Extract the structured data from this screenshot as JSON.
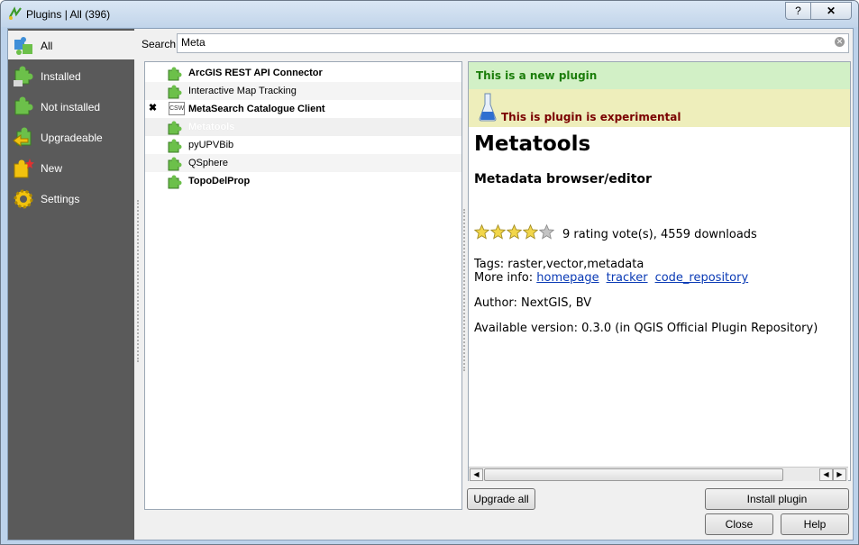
{
  "window": {
    "title": "Plugins | All (396)",
    "help_glyph": "?",
    "close_glyph": "✕"
  },
  "sidebar": {
    "items": [
      {
        "label": "All",
        "icon": "puzzle-all-icon",
        "active": true
      },
      {
        "label": "Installed",
        "icon": "puzzle-installed-icon"
      },
      {
        "label": "Not installed",
        "icon": "puzzle-not-installed-icon"
      },
      {
        "label": "Upgradeable",
        "icon": "puzzle-upgradeable-icon"
      },
      {
        "label": "New",
        "icon": "puzzle-new-icon"
      },
      {
        "label": "Settings",
        "icon": "gear-icon"
      }
    ]
  },
  "search": {
    "label": "Search",
    "value": "Meta"
  },
  "plugin_list": [
    {
      "name": "ArcGIS REST API Connector",
      "bold": true,
      "checked": false,
      "icon": "puzzle-icon"
    },
    {
      "name": "Interactive Map Tracking",
      "bold": false,
      "checked": false,
      "icon": "puzzle-icon"
    },
    {
      "name": "MetaSearch Catalogue Client",
      "bold": true,
      "checked": true,
      "check_glyph": "✖",
      "icon": "csw-icon",
      "icon_text": "CSW"
    },
    {
      "name": "Metatools",
      "bold": true,
      "checked": false,
      "selected": true,
      "icon": "puzzle-icon"
    },
    {
      "name": "pyUPVBib",
      "bold": false,
      "checked": false,
      "icon": "puzzle-icon"
    },
    {
      "name": "QSphere",
      "bold": false,
      "checked": false,
      "icon": "puzzle-icon"
    },
    {
      "name": "TopoDelProp",
      "bold": true,
      "checked": false,
      "icon": "puzzle-icon"
    }
  ],
  "detail": {
    "new_banner": "This is a new plugin",
    "experimental_banner": "This is plugin is experimental",
    "title": "Metatools",
    "subtitle": "Metadata browser/editor",
    "rating_stars": 4,
    "rating_max": 5,
    "rating_text": "9 rating vote(s), 4559 downloads",
    "tags_line": "Tags: raster,vector,metadata",
    "more_info_label": "More info:",
    "links": [
      "homepage",
      "tracker",
      "code_repository"
    ],
    "author_line": "Author: NextGIS, BV",
    "version_line": "Available version: 0.3.0 (in QGIS Official Plugin Repository)"
  },
  "buttons": {
    "upgrade_all": "Upgrade all",
    "install_plugin": "Install plugin",
    "close": "Close",
    "help": "Help"
  },
  "colors": {
    "sidebar_bg": "#5a5a5a",
    "new_banner_bg": "#d2f0c6",
    "new_banner_text": "#1b7d0a",
    "experimental_bg": "#eeeebb",
    "experimental_text": "#7a0000",
    "link": "#0a3ab5"
  }
}
